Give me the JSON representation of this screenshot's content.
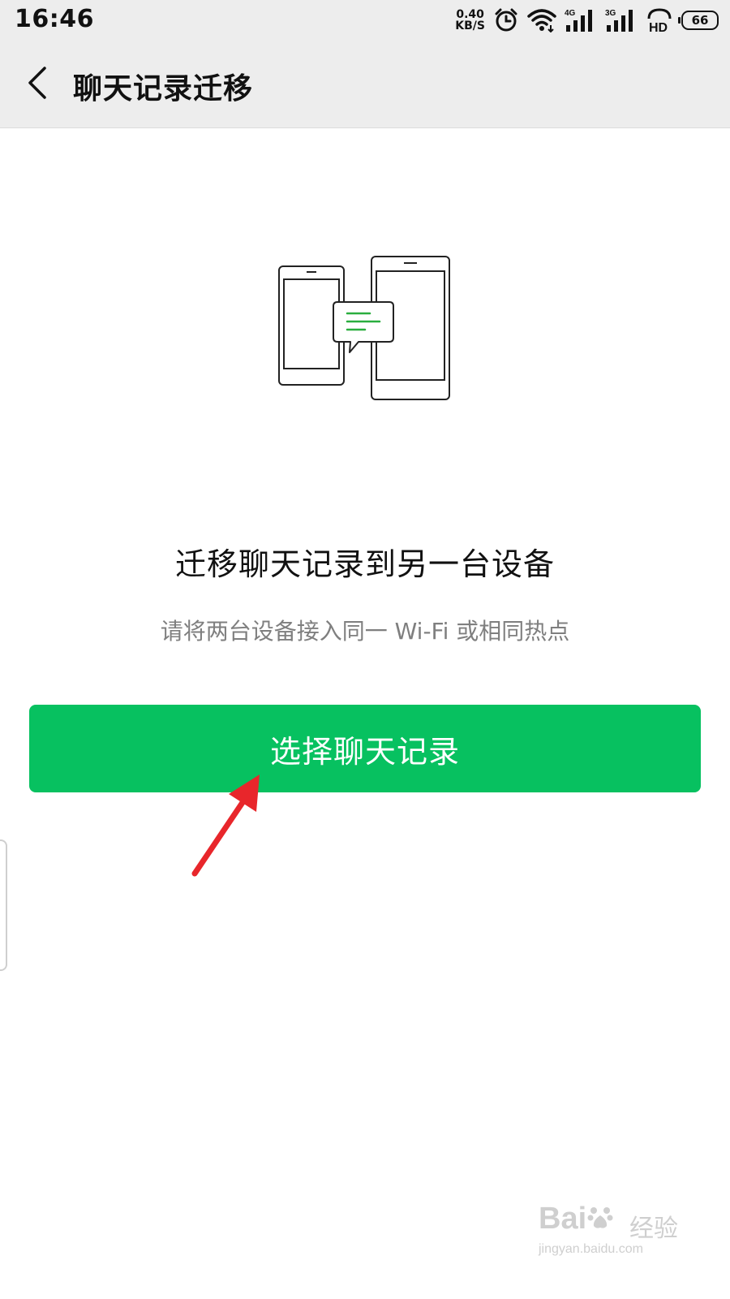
{
  "status_bar": {
    "time": "16:46",
    "net_speed_value": "0.40",
    "net_speed_unit": "KB/S",
    "signal_1_label": "4G",
    "signal_2_label": "3G",
    "hd_label": "HD",
    "battery_level": "66"
  },
  "nav": {
    "title": "聊天记录迁移"
  },
  "main": {
    "headline": "迁移聊天记录到另一台设备",
    "subtext": "请将两台设备接入同一 Wi-Fi 或相同热点",
    "button_label": "选择聊天记录"
  },
  "watermark": {
    "logo_text_1": "Bai",
    "logo_text_2": "经验",
    "url": "jingyan.baidu.com"
  },
  "colors": {
    "accent": "#07c160",
    "annotation_arrow": "#e8262b",
    "bar_background": "#ededed",
    "illustration_green": "#2aae3f"
  }
}
